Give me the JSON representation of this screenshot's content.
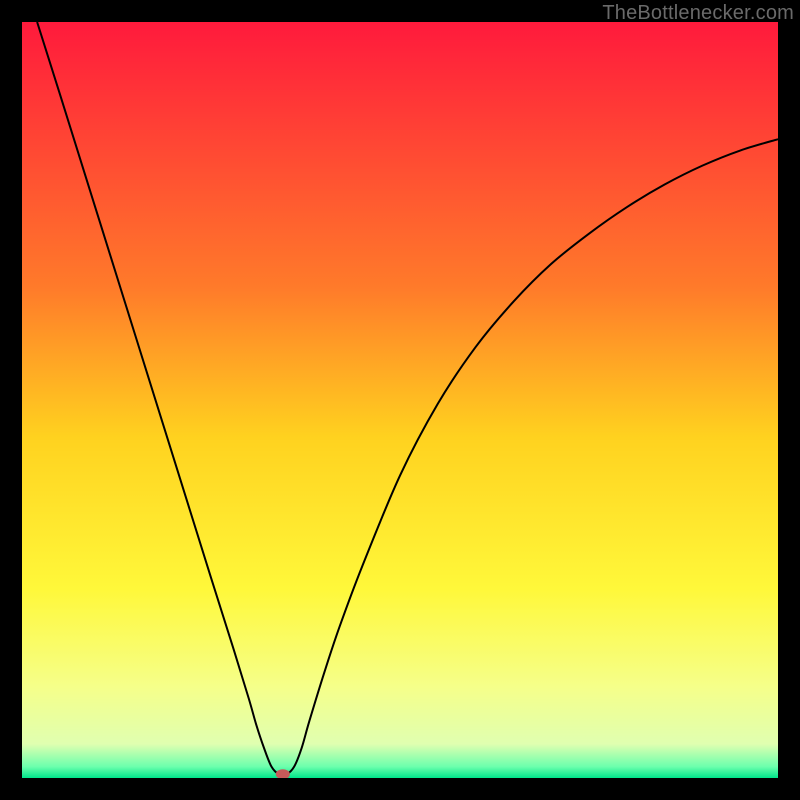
{
  "watermark": "TheBottlenecker.com",
  "chart_data": {
    "type": "line",
    "title": "",
    "xlabel": "",
    "ylabel": "",
    "xlim": [
      0,
      100
    ],
    "ylim": [
      0,
      100
    ],
    "background_gradient": {
      "stops": [
        {
          "offset": 0.0,
          "color": "#ff1a3c"
        },
        {
          "offset": 0.35,
          "color": "#ff7a2a"
        },
        {
          "offset": 0.55,
          "color": "#ffd21f"
        },
        {
          "offset": 0.75,
          "color": "#fff83a"
        },
        {
          "offset": 0.88,
          "color": "#f5ff8a"
        },
        {
          "offset": 0.955,
          "color": "#e0ffb0"
        },
        {
          "offset": 0.985,
          "color": "#6cffad"
        },
        {
          "offset": 1.0,
          "color": "#00e58a"
        }
      ]
    },
    "series": [
      {
        "name": "bottleneck-curve",
        "color": "#000000",
        "stroke_width": 2,
        "x": [
          2,
          5,
          10,
          15,
          20,
          25,
          28,
          30,
          31,
          32,
          33,
          34,
          35,
          36,
          37,
          38,
          40,
          42,
          45,
          50,
          55,
          60,
          65,
          70,
          75,
          80,
          85,
          90,
          95,
          100
        ],
        "y": [
          100,
          90.5,
          74.5,
          58.5,
          42.5,
          26.5,
          17,
          10.5,
          7,
          4,
          1.5,
          0.5,
          0.5,
          1.5,
          4,
          7.5,
          14,
          20,
          28,
          40,
          49.5,
          57,
          63,
          68,
          72,
          75.5,
          78.5,
          81,
          83,
          84.5
        ]
      }
    ],
    "marker": {
      "name": "optimal-point",
      "x": 34.5,
      "y": 0.5,
      "color": "#c75a5a",
      "rx": 7,
      "ry": 5
    }
  }
}
